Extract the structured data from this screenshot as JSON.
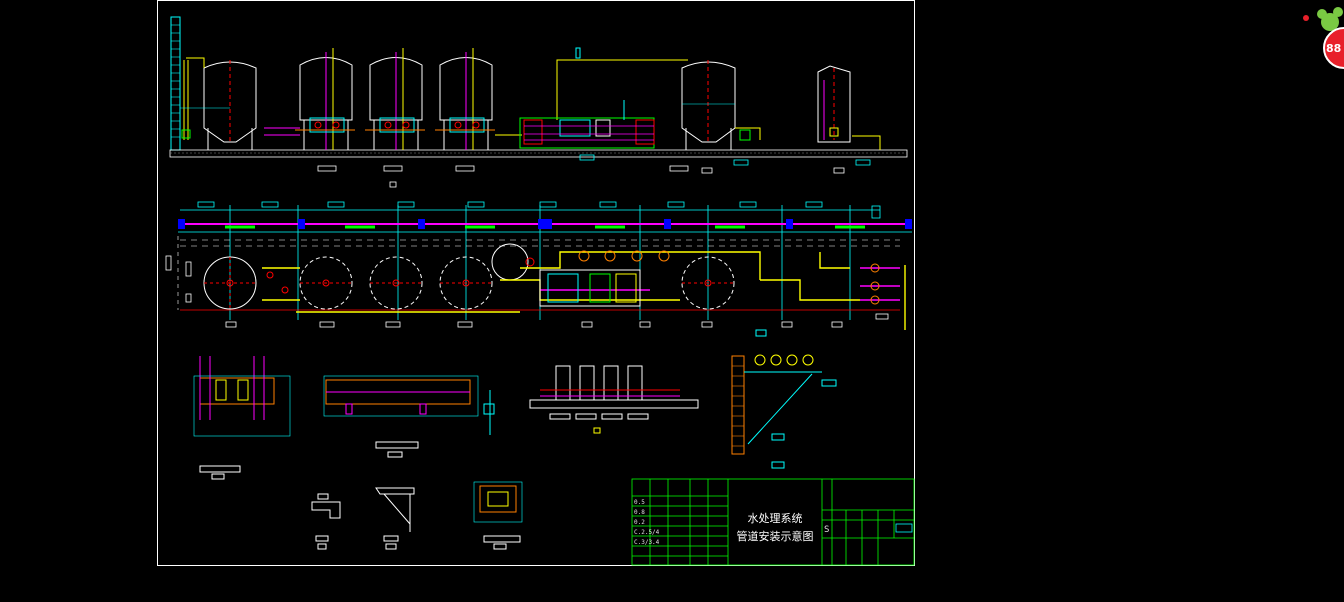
{
  "title_block": {
    "title_line1": "水处理系统",
    "title_line2": "管道安装示意图",
    "scale_mark": "S",
    "left_col_codes": [
      "0.5",
      "0.8",
      "0.2",
      "C.2.5/4",
      "C.3/3.4"
    ]
  },
  "badge": {
    "count": "88"
  },
  "colors": {
    "background": "#000000",
    "frame": "#ffffff",
    "tank": "#ffffff",
    "pipe_yellow": "#ffff00",
    "pipe_magenta": "#ff00ff",
    "dimension_cyan": "#00ffff",
    "pipe_green": "#00ff00",
    "pipe_red": "#ff0000",
    "valve_blue": "#0000ff",
    "pipe_orange": "#ff8000",
    "badge_red": "#e8202a",
    "badge_green": "#7ac943"
  },
  "icons": {
    "tank": "vertical-tank-icon",
    "pump": "pump-icon",
    "valve": "valve-icon",
    "badge": "notification-badge-icon"
  }
}
